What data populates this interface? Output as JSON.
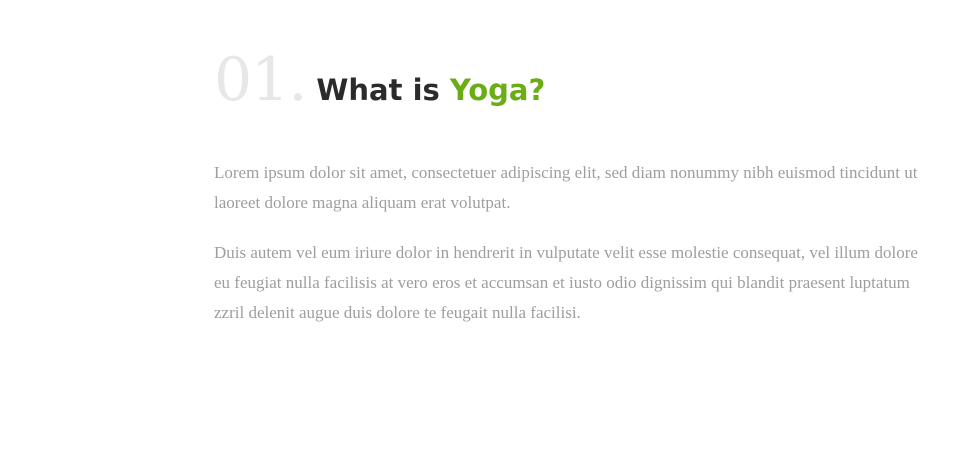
{
  "section": {
    "number": "01.",
    "title_prefix": "What is ",
    "title_accent": "Yoga?",
    "paragraphs": [
      "Lorem ipsum dolor sit amet, consectetuer adipiscing elit, sed diam nonummy nibh euismod tincidunt ut laoreet dolore magna aliquam erat volutpat.",
      "Duis autem vel eum iriure dolor in hendrerit in vulputate velit esse molestie consequat, vel illum dolore eu feugiat nulla facilisis at vero eros et accumsan et iusto odio dignissim qui blandit praesent luptatum zzril delenit augue duis dolore te feugait nulla facilisi."
    ]
  },
  "colors": {
    "number": "#e7e7e7",
    "title": "#2b2b2b",
    "accent": "#6aad15",
    "body_text": "#9e9e9e",
    "background": "#ffffff"
  }
}
